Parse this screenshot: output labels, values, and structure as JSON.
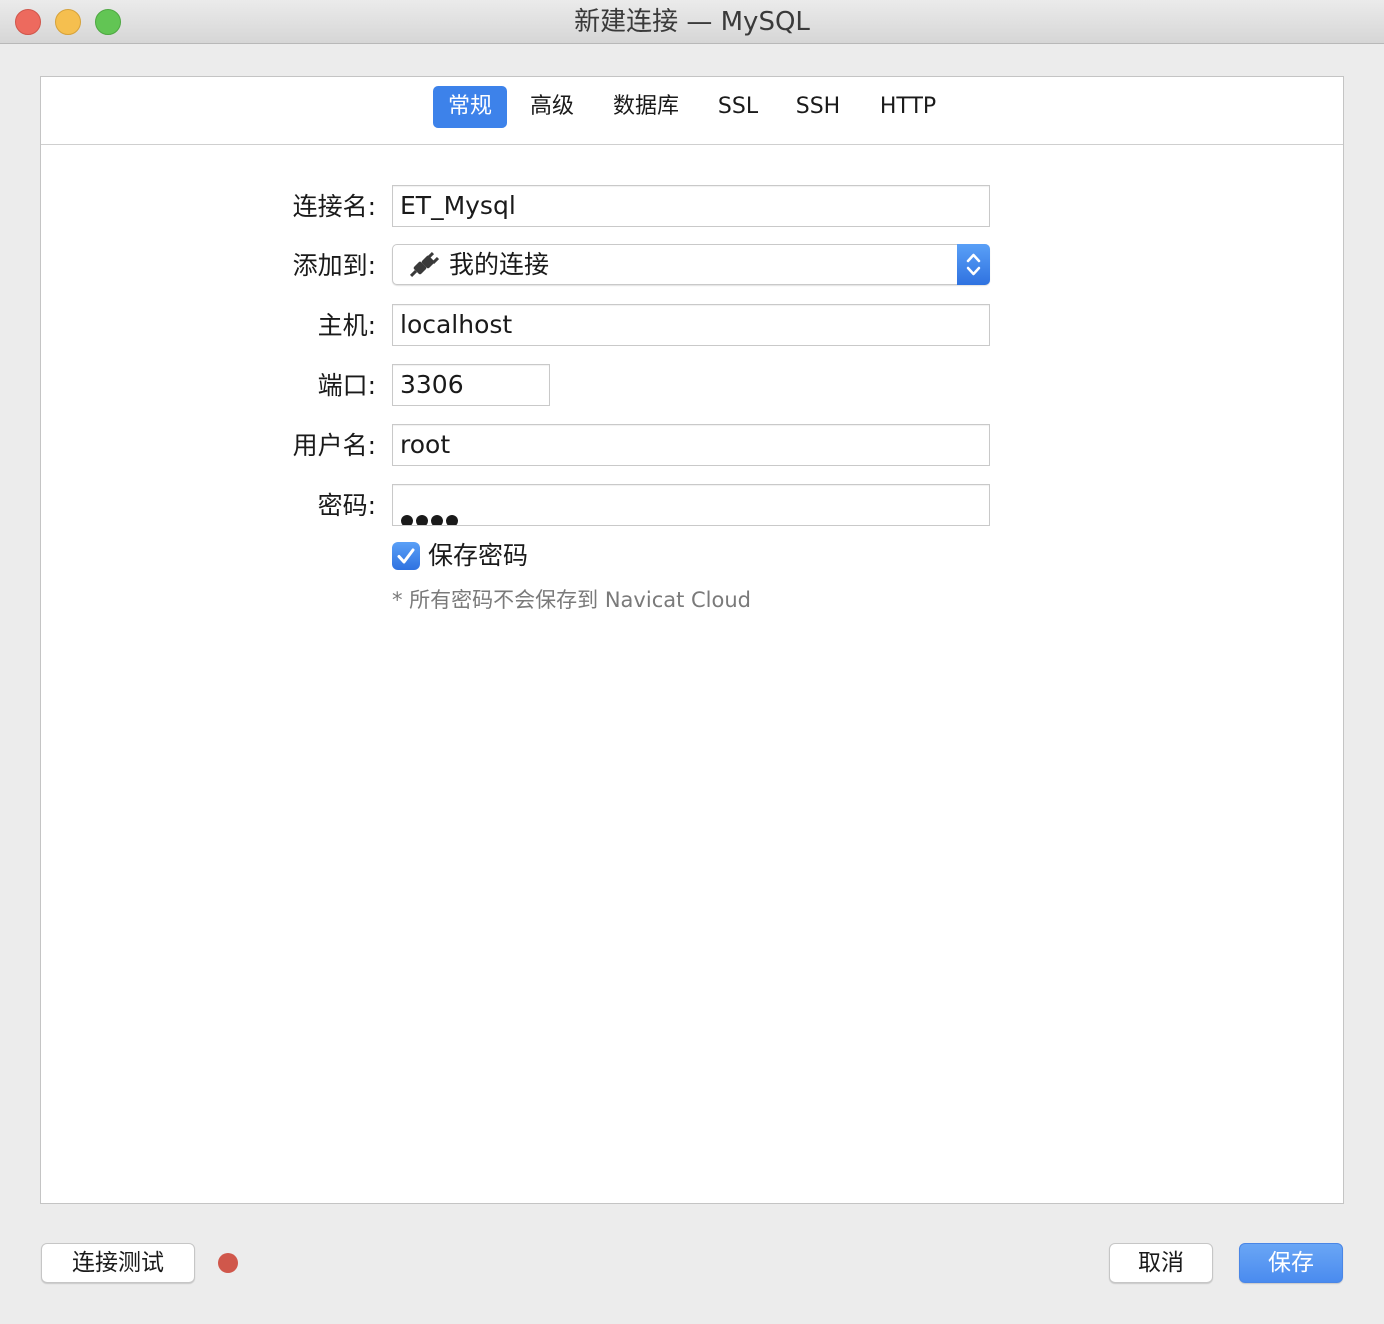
{
  "window": {
    "title": "新建连接 — MySQL"
  },
  "tabs": [
    {
      "label": "常规",
      "active": true
    },
    {
      "label": "高级",
      "active": false
    },
    {
      "label": "数据库",
      "active": false
    },
    {
      "label": "SSL",
      "active": false
    },
    {
      "label": "SSH",
      "active": false
    },
    {
      "label": "HTTP",
      "active": false
    }
  ],
  "form": {
    "connection_name": {
      "label": "连接名:",
      "value": "ET_Mysql"
    },
    "add_to": {
      "label": "添加到:",
      "value": "我的连接",
      "icon": "plug-icon"
    },
    "host": {
      "label": "主机:",
      "value": "localhost"
    },
    "port": {
      "label": "端口:",
      "value": "3306"
    },
    "username": {
      "label": "用户名:",
      "value": "root"
    },
    "password": {
      "label": "密码:",
      "masked_length": 4
    },
    "save_password": {
      "label": "保存密码",
      "checked": true
    },
    "note": "* 所有密码不会保存到 Navicat Cloud"
  },
  "footer": {
    "test_button": "连接测试",
    "cancel_button": "取消",
    "save_button": "保存",
    "status_color": "#d0574b"
  },
  "colors": {
    "accent": "#3d82ea"
  }
}
